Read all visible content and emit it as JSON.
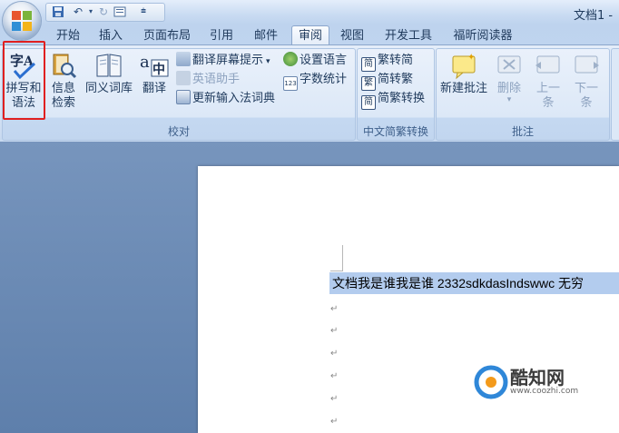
{
  "window": {
    "title": "文档1 -"
  },
  "quick_access": {
    "save_icon": "save-icon",
    "undo_icon": "undo-icon",
    "redo_icon": "redo-icon",
    "print_preview_icon": "print-preview-icon",
    "customize_icon": "customize-qat-icon"
  },
  "tabs": [
    {
      "label": "开始",
      "active": false
    },
    {
      "label": "插入",
      "active": false
    },
    {
      "label": "页面布局",
      "active": false
    },
    {
      "label": "引用",
      "active": false
    },
    {
      "label": "邮件",
      "active": false
    },
    {
      "label": "审阅",
      "active": true
    },
    {
      "label": "视图",
      "active": false
    },
    {
      "label": "开发工具",
      "active": false
    },
    {
      "label": "福昕阅读器",
      "active": false
    }
  ],
  "ribbon": {
    "proofing": {
      "label": "校对",
      "spelling_line1": "拼写和",
      "spelling_line2": "语法",
      "research_line1": "信息",
      "research_line2": "检索",
      "thesaurus": "同义词库",
      "translate": "翻译",
      "translate_screentip": "翻译屏幕提示",
      "english_assistant": "英语助手",
      "set_language": "设置语言",
      "word_count": "字数统计",
      "update_ime": "更新输入法词典"
    },
    "chinese_conversion": {
      "label": "中文简繁转换",
      "to_simplified": "繁转简",
      "to_traditional": "简转繁",
      "convert": "简繁转换"
    },
    "comments": {
      "label": "批注",
      "new_comment": "新建批注",
      "delete": "删除",
      "previous_line1": "上一",
      "previous_line2": "条",
      "next_line1": "下一",
      "next_line2": "条"
    }
  },
  "document": {
    "first_line": "文档我是谁我是谁 2332sdkdasIndswwc 无穷",
    "para_mark": "↵"
  },
  "watermark": {
    "name": "酷知网",
    "url": "www.coozhi.com"
  },
  "colors": {
    "highlight_border": "#e02020",
    "selection": "#b3ccee",
    "ribbon_bg": "#dce8f7"
  }
}
